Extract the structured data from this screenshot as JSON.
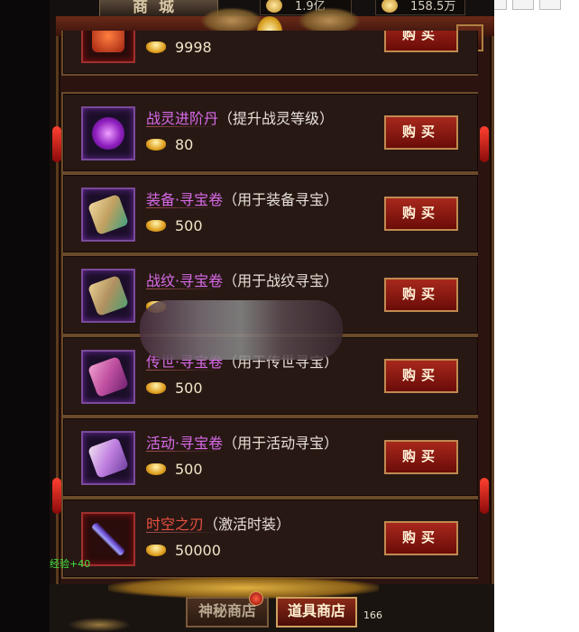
{
  "header": {
    "title": "商城",
    "resource1": "1.9亿",
    "resource2": "158.5万"
  },
  "close_label": "✕",
  "items": [
    {
      "name": "",
      "desc": "",
      "price": "9998",
      "buy": "购买",
      "icon": "item-icon"
    },
    {
      "name": "战灵进阶丹",
      "desc": "（提升战灵等级）",
      "price": "80",
      "buy": "购买",
      "icon": "purple-orb-icon"
    },
    {
      "name": "装备·寻宝卷",
      "desc": "（用于装备寻宝）",
      "price": "500",
      "buy": "购买",
      "icon": "scroll-icon"
    },
    {
      "name": "战纹·寻宝卷",
      "desc": "（用于战纹寻宝）",
      "price": "",
      "buy": "购买",
      "icon": "scroll-icon"
    },
    {
      "name": "传世·寻宝卷",
      "desc": "（用于传世寻宝）",
      "price": "500",
      "buy": "购买",
      "icon": "scroll-icon"
    },
    {
      "name": "活动·寻宝卷",
      "desc": "（用于活动寻宝）",
      "price": "500",
      "buy": "购买",
      "icon": "scroll-icon"
    },
    {
      "name": "时空之刃",
      "desc": "（激活时装）",
      "price": "50000",
      "buy": "购买",
      "icon": "blade-icon"
    }
  ],
  "exp_text": "经验+40",
  "tabs": {
    "mystery": "神秘商店",
    "props": "道具商店"
  },
  "count": "166"
}
